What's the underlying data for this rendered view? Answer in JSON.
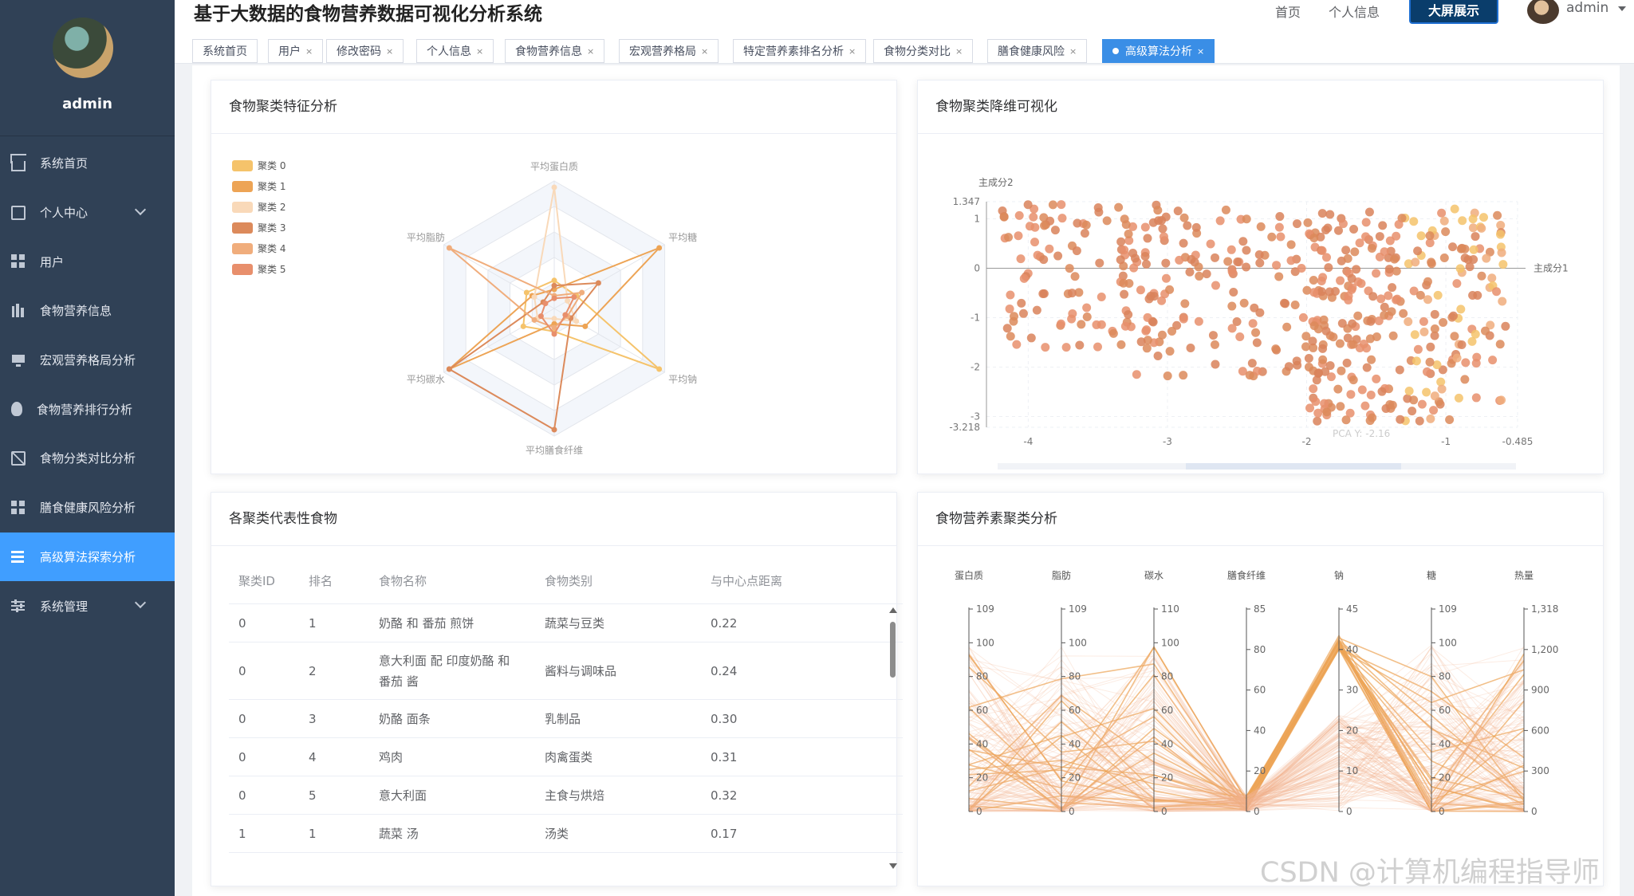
{
  "sidebar": {
    "username": "admin",
    "items": [
      {
        "label": "系统首页",
        "icon": "home-icon",
        "active": false,
        "expandable": false
      },
      {
        "label": "个人中心",
        "icon": "card-icon",
        "active": false,
        "expandable": true
      },
      {
        "label": "用户",
        "icon": "grid-icon",
        "active": false,
        "expandable": false
      },
      {
        "label": "食物营养信息",
        "icon": "chart-bars-icon",
        "active": false,
        "expandable": false
      },
      {
        "label": "宏观营养格局分析",
        "icon": "monitor-icon",
        "active": false,
        "expandable": false
      },
      {
        "label": "食物营养排行分析",
        "icon": "bulb-icon",
        "active": false,
        "expandable": false
      },
      {
        "label": "食物分类对比分析",
        "icon": "clipboard-icon",
        "active": false,
        "expandable": false
      },
      {
        "label": "膳食健康风险分析",
        "icon": "grid-icon",
        "active": false,
        "expandable": false
      },
      {
        "label": "高级算法探索分析",
        "icon": "list-icon",
        "active": true,
        "expandable": false
      },
      {
        "label": "系统管理",
        "icon": "sliders-icon",
        "active": false,
        "expandable": true
      }
    ]
  },
  "header": {
    "title": "基于大数据的食物营养数据可视化分析系统",
    "home_link": "首页",
    "profile_link": "个人信息",
    "bigscreen_button": "大屏展示",
    "user": "admin"
  },
  "tabs": [
    {
      "label": "系统首页",
      "closable": false,
      "active": false
    },
    {
      "label": "用户",
      "closable": true,
      "active": false
    },
    {
      "label": "修改密码",
      "closable": true,
      "active": false
    },
    {
      "label": "个人信息",
      "closable": true,
      "active": false
    },
    {
      "label": "食物营养信息",
      "closable": true,
      "active": false
    },
    {
      "label": "宏观营养格局",
      "closable": true,
      "active": false
    },
    {
      "label": "特定营养素排名分析",
      "closable": true,
      "active": false
    },
    {
      "label": "食物分类对比",
      "closable": true,
      "active": false
    },
    {
      "label": "膳食健康风险",
      "closable": true,
      "active": false
    },
    {
      "label": "高级算法分析",
      "closable": true,
      "active": true
    }
  ],
  "tab_close_glyph": "×",
  "cards": {
    "radar_title": "食物聚类特征分析",
    "scatter_title": "食物聚类降维可视化",
    "table_title": "各聚类代表性食物",
    "parallel_title": "食物营养素聚类分析"
  },
  "colors": {
    "accent": "#409eff",
    "sidebar_bg": "#304156",
    "cluster_colors": [
      "#f5c36b",
      "#eda455",
      "#f9d9b9",
      "#dc8a5b",
      "#f0ad7c",
      "#e88f6c"
    ]
  },
  "chart_data": [
    {
      "type": "radar",
      "indicators": [
        "平均蛋白质",
        "平均糖",
        "平均钠",
        "平均膳食纤维",
        "平均碳水",
        "平均脂肪"
      ],
      "legend": [
        "聚类 0",
        "聚类 1",
        "聚类 2",
        "聚类 3",
        "聚类 4",
        "聚类 5"
      ],
      "legend_position": "top-left",
      "series": [
        {
          "name": "聚类 0",
          "values": [
            0.22,
            0.2,
            0.95,
            0.18,
            0.28,
            0.25
          ]
        },
        {
          "name": "聚类 1",
          "values": [
            0.15,
            0.95,
            0.28,
            0.12,
            0.95,
            0.2
          ]
        },
        {
          "name": "聚类 2",
          "values": [
            0.95,
            0.12,
            0.2,
            0.08,
            0.15,
            0.18
          ]
        },
        {
          "name": "聚类 3",
          "values": [
            0.18,
            0.4,
            0.15,
            0.95,
            0.95,
            0.1
          ]
        },
        {
          "name": "聚类 4",
          "values": [
            0.1,
            0.25,
            0.12,
            0.15,
            0.18,
            0.95
          ]
        },
        {
          "name": "聚类 5",
          "values": [
            0.08,
            0.18,
            0.1,
            0.2,
            0.12,
            0.08
          ]
        }
      ]
    },
    {
      "type": "scatter",
      "xlabel": "主成分1",
      "ylabel": "主成分2",
      "xlim": [
        -4.3,
        -0.485
      ],
      "ylim": [
        -3.218,
        1.347
      ],
      "x_ticks": [
        -4,
        -3,
        -2,
        -1,
        -0.485
      ],
      "y_ticks": [
        1.347,
        1,
        0,
        -1,
        -2,
        -3,
        -3.218
      ],
      "tooltip_visible": "PCA Y: -2.16",
      "point_count": 520
    },
    {
      "type": "table",
      "columns": [
        "聚类ID",
        "排名",
        "食物名称",
        "食物类别",
        "与中心点距离"
      ],
      "rows": [
        [
          "0",
          "1",
          "奶酪 和 番茄 煎饼",
          "蔬菜与豆类",
          "0.22"
        ],
        [
          "0",
          "2",
          "意大利面 配 印度奶酪 和 番茄 酱",
          "酱料与调味品",
          "0.24"
        ],
        [
          "0",
          "3",
          "奶酪 面条",
          "乳制品",
          "0.30"
        ],
        [
          "0",
          "4",
          "鸡肉",
          "肉禽蛋类",
          "0.31"
        ],
        [
          "0",
          "5",
          "意大利面",
          "主食与烘焙",
          "0.32"
        ],
        [
          "1",
          "1",
          "蔬菜 汤",
          "汤类",
          "0.17"
        ]
      ]
    },
    {
      "type": "parallel",
      "axes": [
        {
          "name": "蛋白质",
          "max": 109,
          "ticks": [
            "109",
            "100",
            "80",
            "60",
            "40",
            "20",
            "0"
          ]
        },
        {
          "name": "脂肪",
          "max": 109,
          "ticks": [
            "109",
            "100",
            "80",
            "60",
            "40",
            "20",
            "0"
          ]
        },
        {
          "name": "碳水",
          "max": 110,
          "ticks": [
            "110",
            "100",
            "80",
            "60",
            "40",
            "20",
            "0"
          ]
        },
        {
          "name": "膳食纤维",
          "max": 85,
          "ticks": [
            "85",
            "80",
            "60",
            "40",
            "20",
            "0"
          ]
        },
        {
          "name": "钠",
          "max": 45,
          "ticks": [
            "45",
            "40",
            "30",
            "20",
            "10",
            "0"
          ]
        },
        {
          "name": "糖",
          "max": 109,
          "ticks": [
            "109",
            "100",
            "80",
            "60",
            "40",
            "20",
            "0"
          ]
        },
        {
          "name": "热量",
          "max": 1318,
          "ticks": [
            "1,318",
            "1,200",
            "900",
            "600",
            "300",
            "0"
          ]
        }
      ],
      "line_count": 160
    }
  ],
  "watermark": "CSDN @计算机编程指导师"
}
